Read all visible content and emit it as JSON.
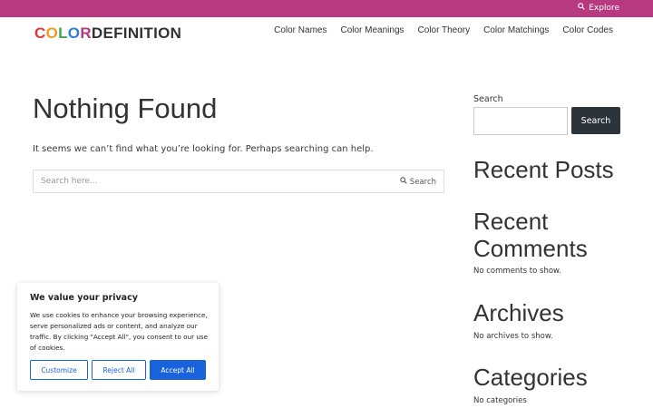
{
  "topbar": {
    "explore_label": "Explore",
    "color": "#b73a80"
  },
  "logo": {
    "letters": [
      {
        "ch": "C",
        "color": "#e8343a"
      },
      {
        "ch": "O",
        "color": "#f39a1e"
      },
      {
        "ch": "L",
        "color": "#3aa75a"
      },
      {
        "ch": "O",
        "color": "#2e7dd7"
      },
      {
        "ch": "R",
        "color": "#b73a80"
      },
      {
        "ch": "DEFINITION",
        "color": "#333333"
      }
    ]
  },
  "nav": {
    "items": [
      {
        "label": "Color Names"
      },
      {
        "label": "Color Meanings"
      },
      {
        "label": "Color Theory"
      },
      {
        "label": "Color Matchings"
      },
      {
        "label": "Color Codes"
      }
    ]
  },
  "main": {
    "title": "Nothing Found",
    "description": "It seems we can’t find what you’re looking for. Perhaps searching can help.",
    "search": {
      "placeholder": "Search here...",
      "button_label": "Search"
    }
  },
  "sidebar": {
    "search_label": "Search",
    "search_button": "Search",
    "widgets": {
      "recent_posts_title": "Recent Posts",
      "recent_comments_title_line1": "Recent",
      "recent_comments_title_line2": "Comments",
      "recent_comments_text": "No comments to show.",
      "archives_title": "Archives",
      "archives_text": "No archives to show.",
      "categories_title": "Categories",
      "categories_text": "No categories"
    }
  },
  "cookie": {
    "title": "We value your privacy",
    "text": "We use cookies to enhance your browsing experience, serve personalized ads or content, and analyze our traffic. By clicking \"Accept All\", you consent to our use of cookies.",
    "customize_label": "Customize",
    "reject_label": "Reject All",
    "accept_label": "Accept All",
    "accent": "#1863dc"
  }
}
